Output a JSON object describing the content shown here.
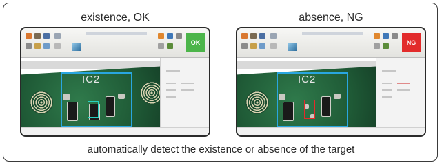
{
  "left_panel": {
    "heading": "existence, OK",
    "chip_label": "IC2",
    "status_text": "OK",
    "status_color": "#4cb54a"
  },
  "right_panel": {
    "heading": "absence, NG",
    "chip_label": "IC2",
    "status_text": "NG",
    "status_color": "#e22b2b"
  },
  "caption": "automatically detect the existence or absence of the target",
  "colors": {
    "roi_box": "#29a6e0",
    "target_ok": "#28d0c0",
    "target_ng": "#e52a2a"
  }
}
